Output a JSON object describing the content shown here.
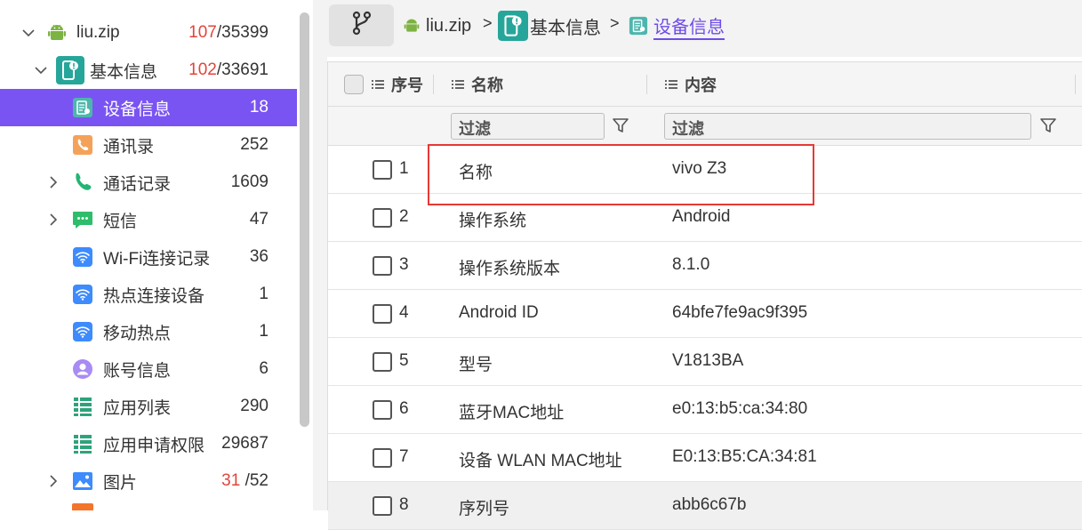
{
  "sidebar": {
    "items": [
      {
        "label": "liu.zip",
        "count_red": "107",
        "count_rest": "/35399",
        "icon": "android-icon",
        "expand": "down"
      },
      {
        "label": "基本信息",
        "count_red": "102",
        "count_rest": "/33691",
        "icon": "info-icon",
        "expand": "down"
      },
      {
        "label": "设备信息",
        "count_red": "",
        "count_rest": "18",
        "icon": "device-info-icon",
        "expand": ""
      },
      {
        "label": "通讯录",
        "count_red": "",
        "count_rest": "252",
        "icon": "contacts-icon",
        "expand": ""
      },
      {
        "label": "通话记录",
        "count_red": "",
        "count_rest": "1609",
        "icon": "phone-icon",
        "expand": "right"
      },
      {
        "label": "短信",
        "count_red": "",
        "count_rest": "47",
        "icon": "sms-icon",
        "expand": "right"
      },
      {
        "label": "Wi-Fi连接记录",
        "count_red": "",
        "count_rest": "36",
        "icon": "wifi-icon",
        "expand": ""
      },
      {
        "label": "热点连接设备",
        "count_red": "",
        "count_rest": "1",
        "icon": "hotspot-wifi-icon",
        "expand": ""
      },
      {
        "label": "移动热点",
        "count_red": "",
        "count_rest": "1",
        "icon": "mobile-hotspot-icon",
        "expand": ""
      },
      {
        "label": "账号信息",
        "count_red": "",
        "count_rest": "6",
        "icon": "account-icon",
        "expand": ""
      },
      {
        "label": "应用列表",
        "count_red": "",
        "count_rest": "290",
        "icon": "app-list-icon",
        "expand": ""
      },
      {
        "label": "应用申请权限",
        "count_red": "",
        "count_rest": "29687",
        "icon": "app-permission-icon",
        "expand": ""
      },
      {
        "label": "图片",
        "count_red": "31",
        "count_rest": " /52",
        "icon": "image-icon",
        "expand": "right"
      }
    ]
  },
  "breadcrumb": {
    "root": "liu.zip",
    "level1": "基本信息",
    "current": "设备信息",
    "separator": ">"
  },
  "table": {
    "headers": {
      "index": "序号",
      "name": "名称",
      "content": "内容"
    },
    "filter_placeholder": "过滤",
    "rows": [
      {
        "index": "1",
        "name": "名称",
        "value": "vivo Z3"
      },
      {
        "index": "2",
        "name": "操作系统",
        "value": "Android"
      },
      {
        "index": "3",
        "name": "操作系统版本",
        "value": "8.1.0"
      },
      {
        "index": "4",
        "name": "Android ID",
        "value": "64bfe7fe9ac9f395"
      },
      {
        "index": "5",
        "name": "型号",
        "value": "V1813BA"
      },
      {
        "index": "6",
        "name": "蓝牙MAC地址",
        "value": "e0:13:b5:ca:34:80"
      },
      {
        "index": "7",
        "name": "设备 WLAN MAC地址",
        "value": "E0:13:B5:CA:34:81"
      },
      {
        "index": "8",
        "name": "序列号",
        "value": "abb6c67b"
      }
    ]
  },
  "colors": {
    "accent": "#7a54f2",
    "highlight": "#e53935",
    "count_red": "#e0453a"
  }
}
